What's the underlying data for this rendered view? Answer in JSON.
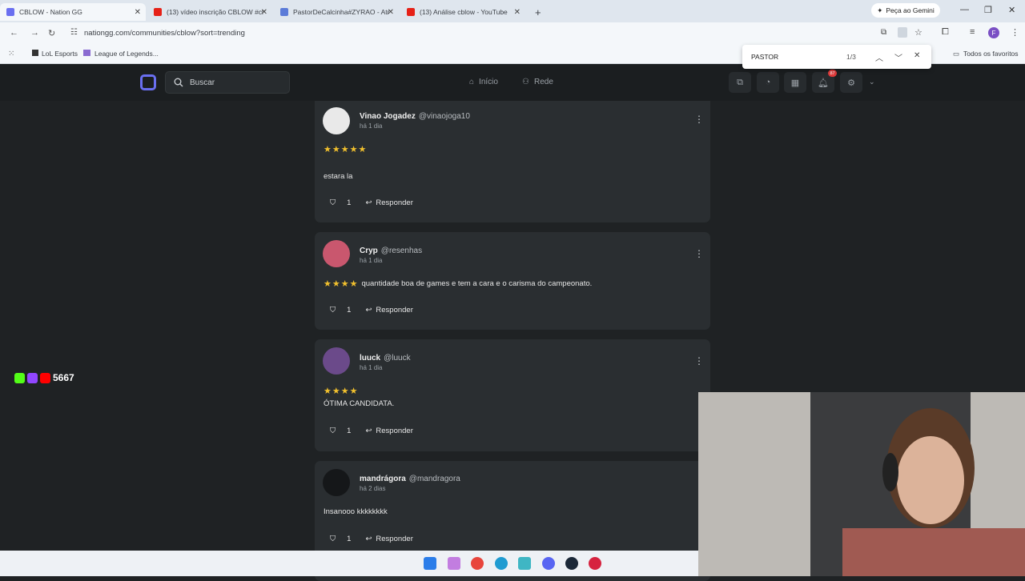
{
  "browser": {
    "tabs": [
      {
        "label": "CBLOW - Nation GG"
      },
      {
        "label": "(13) vídeo inscrição CBLOW #cl"
      },
      {
        "label": "PastorDeCalcinha#ZYRAO - Atr"
      },
      {
        "label": "(13) Análise cblow - YouTube"
      }
    ],
    "gemini_label": "Peça ao Gemini",
    "url": "nationgg.com/communities/cblow?sort=trending",
    "bookmarks": [
      {
        "label": "LoL Esports"
      },
      {
        "label": "League of Legends..."
      }
    ],
    "all_favorites": "Todos os favoritos",
    "find": {
      "query": "PASTOR",
      "count": "1/3"
    }
  },
  "site": {
    "search_placeholder": "Buscar",
    "nav": {
      "home": "Início",
      "network": "Rede"
    },
    "notification_count": "87"
  },
  "posts": [
    {
      "name": "Vinao Jogadez",
      "handle": "@vinaojoga10",
      "time": "há 1 dia",
      "stars": "★★★★★",
      "text": "estara la",
      "likes": "1",
      "reply": "Responder"
    },
    {
      "name": "Cryp",
      "handle": "@resenhas",
      "time": "há 1 dia",
      "stars": "★★★★",
      "text": "quantidade boa de games e tem a cara e o carisma do campeonato.",
      "likes": "1",
      "reply": "Responder"
    },
    {
      "name": "luuck",
      "handle": "@luuck",
      "time": "há 1 dia",
      "stars": "★★★★",
      "text": "ÓTIMA CANDIDATA.",
      "likes": "1",
      "reply": "Responder"
    },
    {
      "name": "mandrágora",
      "handle": "@mandragora",
      "time": "há 2 dias",
      "stars": "",
      "text": "Insanooo kkkkkkkk",
      "likes": "1",
      "reply": "Responder"
    }
  ],
  "stream": {
    "viewers": "5667"
  },
  "colors": {
    "accent": "#6a6ff0",
    "star": "#f2c12e",
    "card": "#2a2e31",
    "page": "#1f2224",
    "badge": "#e03b3b"
  }
}
